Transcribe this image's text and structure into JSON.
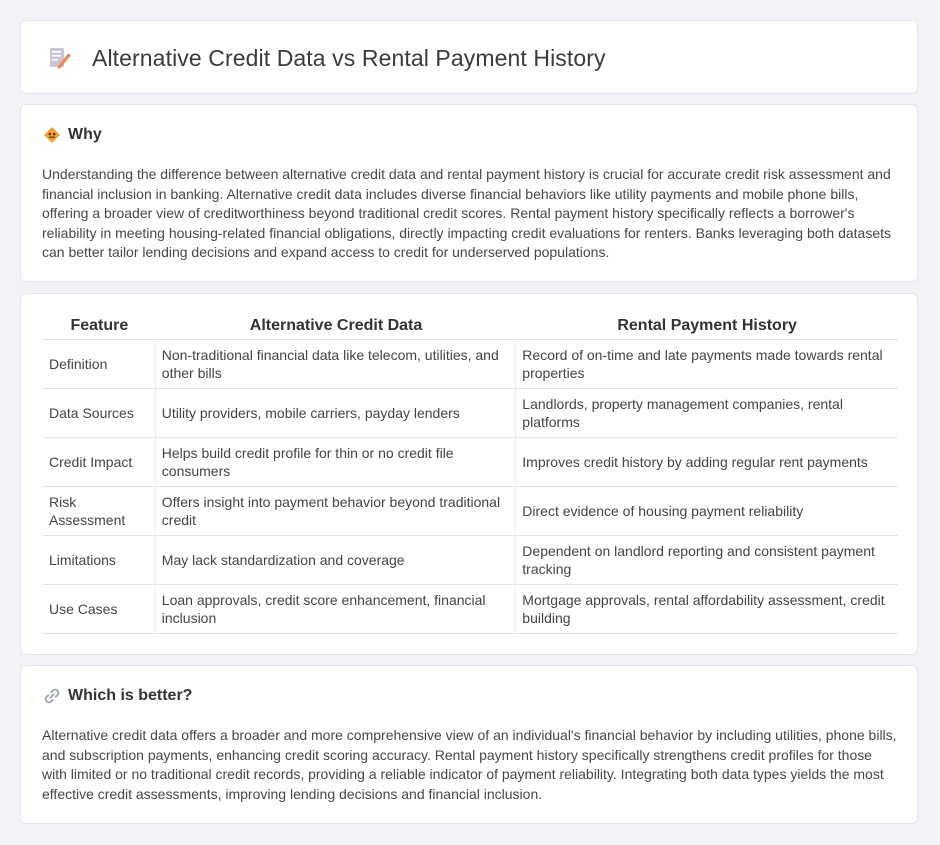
{
  "header": {
    "title": "Alternative Credit Data vs Rental Payment History",
    "icon": "document-pencil-icon"
  },
  "why": {
    "title": "Why",
    "icon": "diamond-sign-icon",
    "text": "Understanding the difference between alternative credit data and rental payment history is crucial for accurate credit risk assessment and financial inclusion in banking. Alternative credit data includes diverse financial behaviors like utility payments and mobile phone bills, offering a broader view of creditworthiness beyond traditional credit scores. Rental payment history specifically reflects a borrower's reliability in meeting housing-related financial obligations, directly impacting credit evaluations for renters. Banks leveraging both datasets can better tailor lending decisions and expand access to credit for underserved populations."
  },
  "comparison": {
    "headers": [
      "Feature",
      "Alternative Credit Data",
      "Rental Payment History"
    ],
    "rows": [
      [
        "Definition",
        "Non-traditional financial data like telecom, utilities, and other bills",
        "Record of on-time and late payments made towards rental properties"
      ],
      [
        "Data Sources",
        "Utility providers, mobile carriers, payday lenders",
        "Landlords, property management companies, rental platforms"
      ],
      [
        "Credit Impact",
        "Helps build credit profile for thin or no credit file consumers",
        "Improves credit history by adding regular rent payments"
      ],
      [
        "Risk Assessment",
        "Offers insight into payment behavior beyond traditional credit",
        "Direct evidence of housing payment reliability"
      ],
      [
        "Limitations",
        "May lack standardization and coverage",
        "Dependent on landlord reporting and consistent payment tracking"
      ],
      [
        "Use Cases",
        "Loan approvals, credit score enhancement, financial inclusion",
        "Mortgage approvals, rental affordability assessment, credit building"
      ]
    ]
  },
  "better": {
    "title": "Which is better?",
    "icon": "link-icon",
    "text": "Alternative credit data offers a broader and more comprehensive view of an individual's financial behavior by including utilities, phone bills, and subscription payments, enhancing credit scoring accuracy. Rental payment history specifically strengthens credit profiles for those with limited or no traditional credit records, providing a reliable indicator of payment reliability. Integrating both data types yields the most effective credit assessments, improving lending decisions and financial inclusion."
  },
  "colors": {
    "background": "#f1f3f8",
    "card": "#ffffff",
    "accent_orange": "#f0a030"
  }
}
